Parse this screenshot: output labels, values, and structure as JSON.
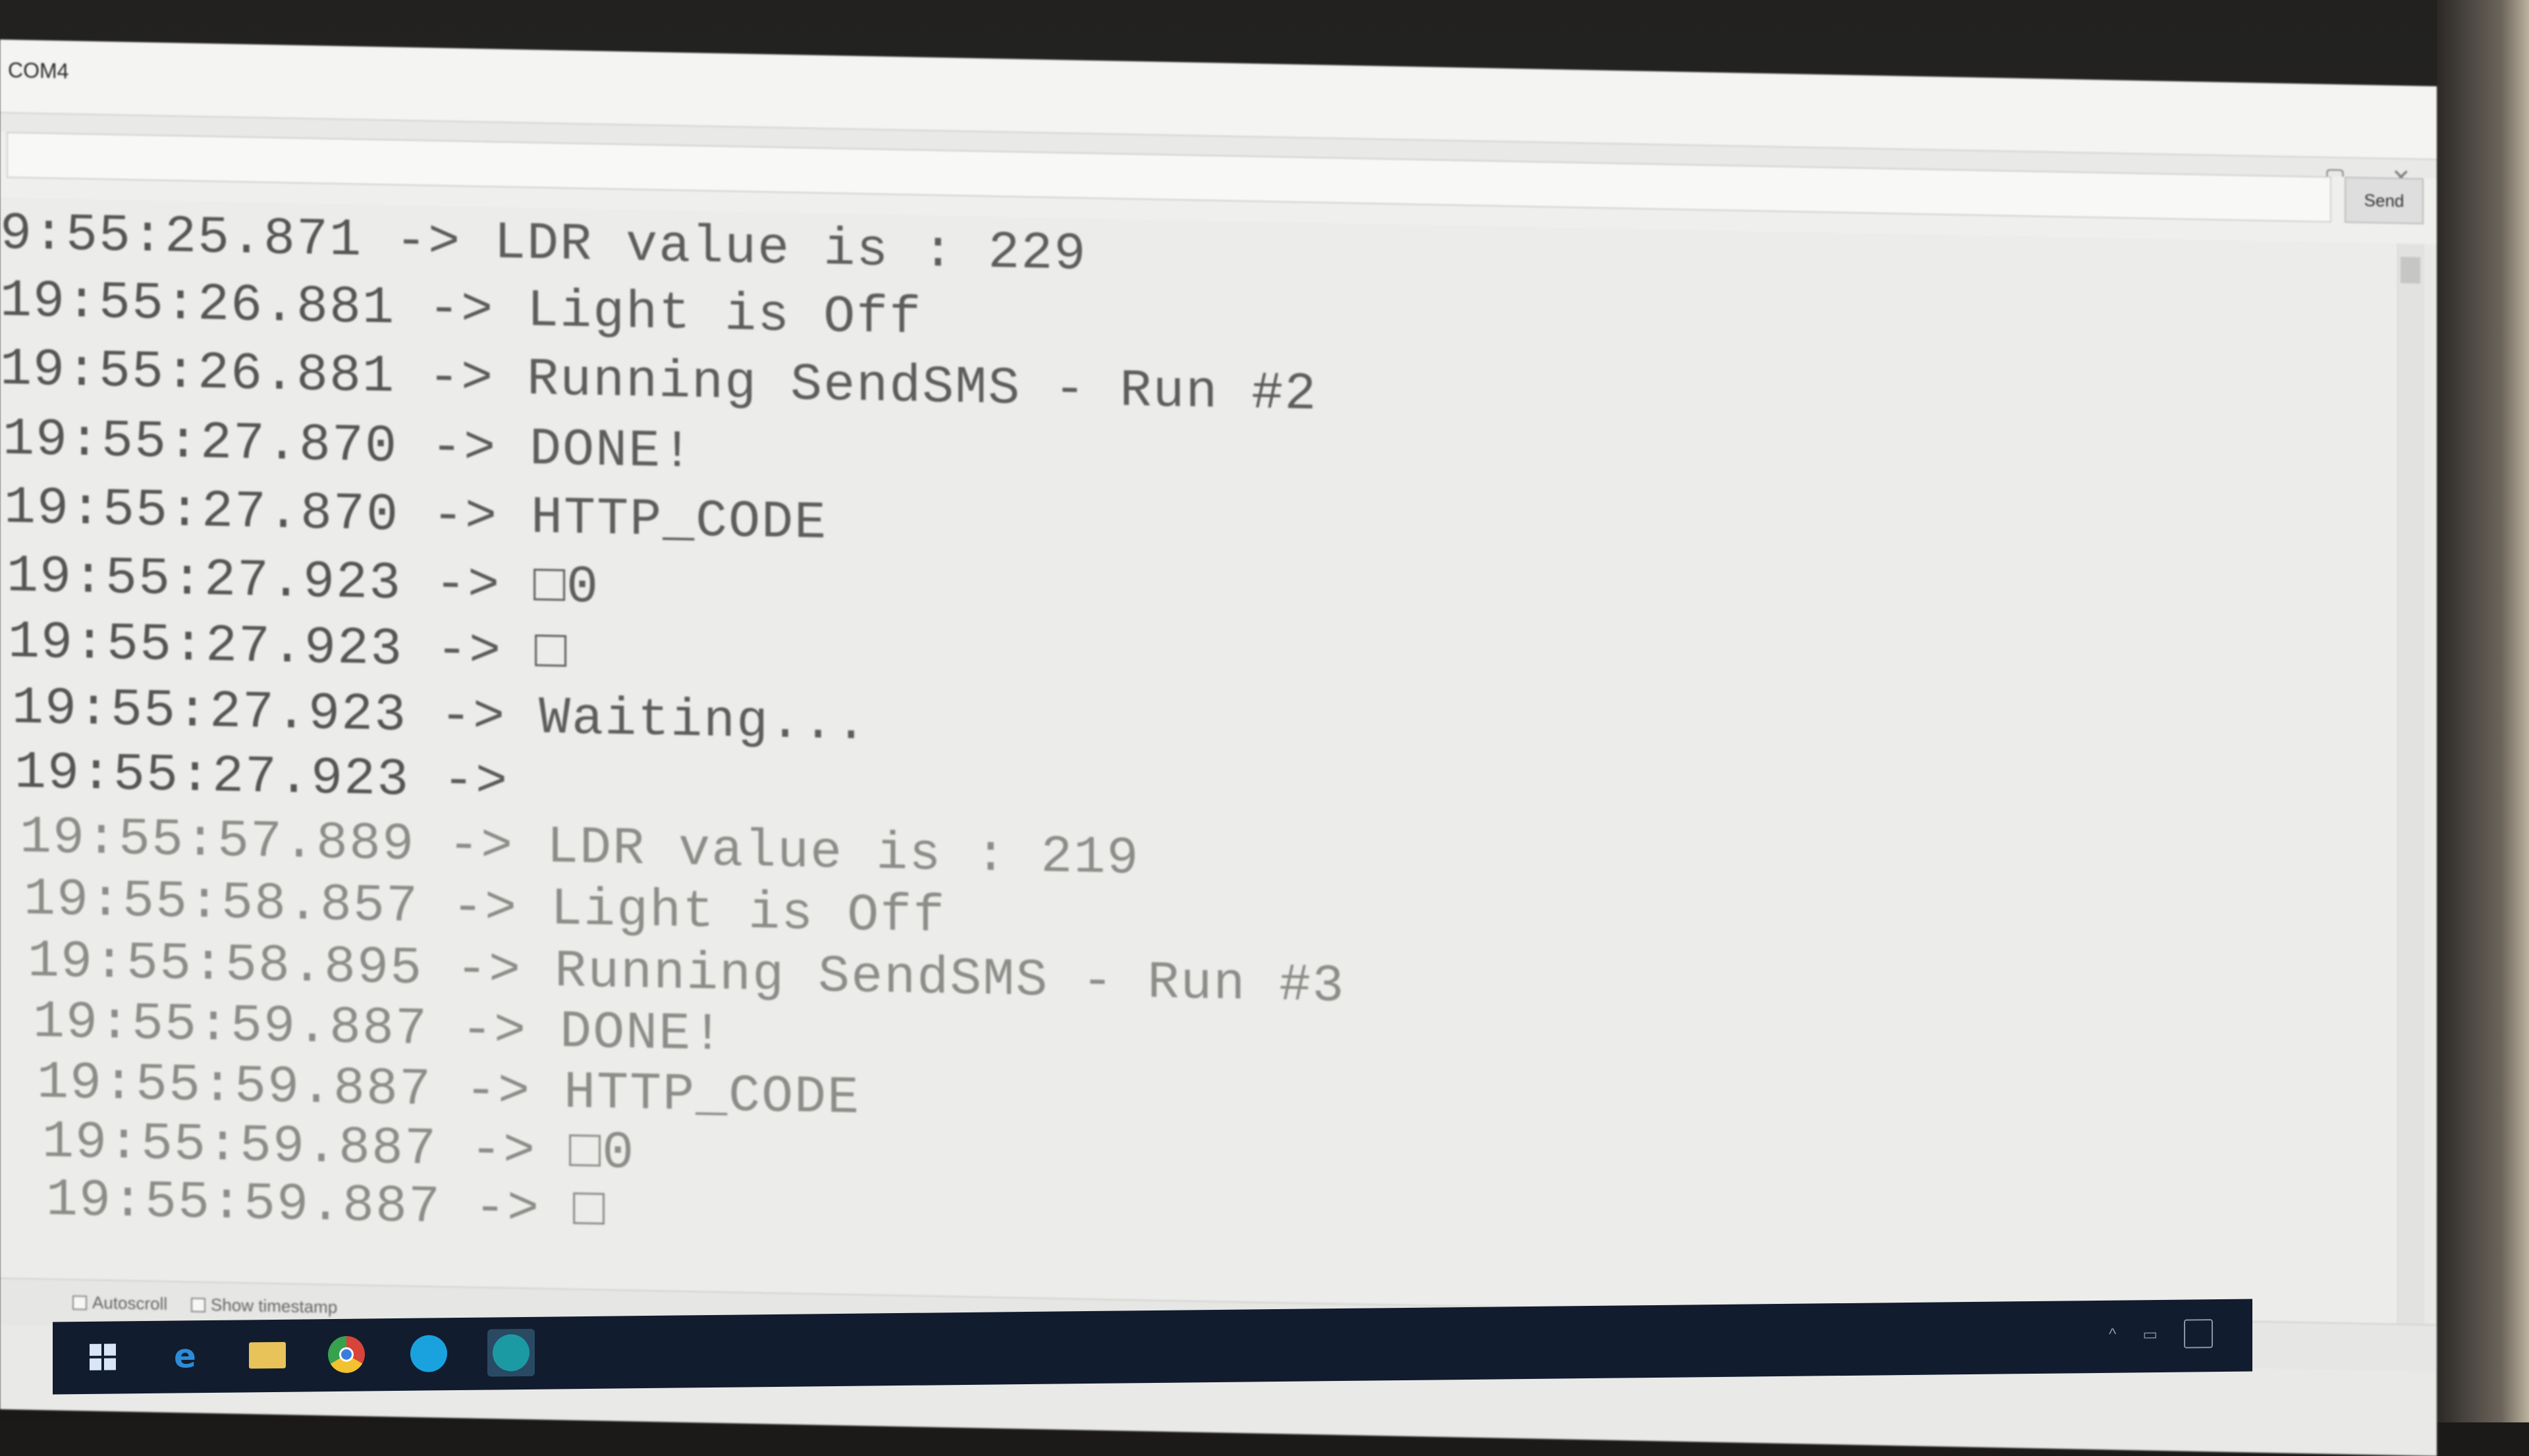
{
  "window": {
    "title": "COM4",
    "controls": [
      "—",
      "▢",
      "✕"
    ]
  },
  "send": {
    "input_value": "",
    "button_label": "Send"
  },
  "serial_log": [
    {
      "time": "9:55:25.871",
      "arrow": "->",
      "message": "LDR value is : 229",
      "faded": false
    },
    {
      "time": "19:55:26.881",
      "arrow": "->",
      "message": "Light is Off",
      "faded": false
    },
    {
      "time": "19:55:26.881",
      "arrow": "->",
      "message": "Running SendSMS - Run #2",
      "faded": false
    },
    {
      "time": "19:55:27.870",
      "arrow": "->",
      "message": "DONE!",
      "faded": false
    },
    {
      "time": "19:55:27.870",
      "arrow": "->",
      "message": "HTTP_CODE",
      "faded": false
    },
    {
      "time": "19:55:27.923",
      "arrow": "->",
      "message": "□0",
      "faded": false
    },
    {
      "time": "19:55:27.923",
      "arrow": "->",
      "message": "□",
      "faded": false
    },
    {
      "time": "19:55:27.923",
      "arrow": "->",
      "message": "Waiting...",
      "faded": false
    },
    {
      "time": "19:55:27.923",
      "arrow": "->",
      "message": "",
      "faded": false
    },
    {
      "time": "19:55:57.889",
      "arrow": "->",
      "message": "LDR value is : 219",
      "faded": true
    },
    {
      "time": "19:55:58.857",
      "arrow": "->",
      "message": "Light is Off",
      "faded": true
    },
    {
      "time": "19:55:58.895",
      "arrow": "->",
      "message": "Running SendSMS - Run #3",
      "faded": true
    },
    {
      "time": "19:55:59.887",
      "arrow": "->",
      "message": "DONE!",
      "faded": true
    },
    {
      "time": "19:55:59.887",
      "arrow": "->",
      "message": "HTTP_CODE",
      "faded": true
    },
    {
      "time": "19:55:59.887",
      "arrow": "->",
      "message": "□0",
      "faded": true
    },
    {
      "time": "19:55:59.887",
      "arrow": "->",
      "message": "□",
      "faded": true
    }
  ],
  "options": {
    "autoscroll_label": "Autoscroll",
    "timestamp_label": "Show timestamp"
  },
  "taskbar": {
    "icons": [
      "windows-start-icon",
      "edge-icon",
      "file-explorer-icon",
      "chrome-icon",
      "skype-icon",
      "arduino-icon"
    ]
  },
  "colors": {
    "output_background": "#ececea",
    "text": "#5a5a58",
    "taskbar": "#111c2e"
  }
}
